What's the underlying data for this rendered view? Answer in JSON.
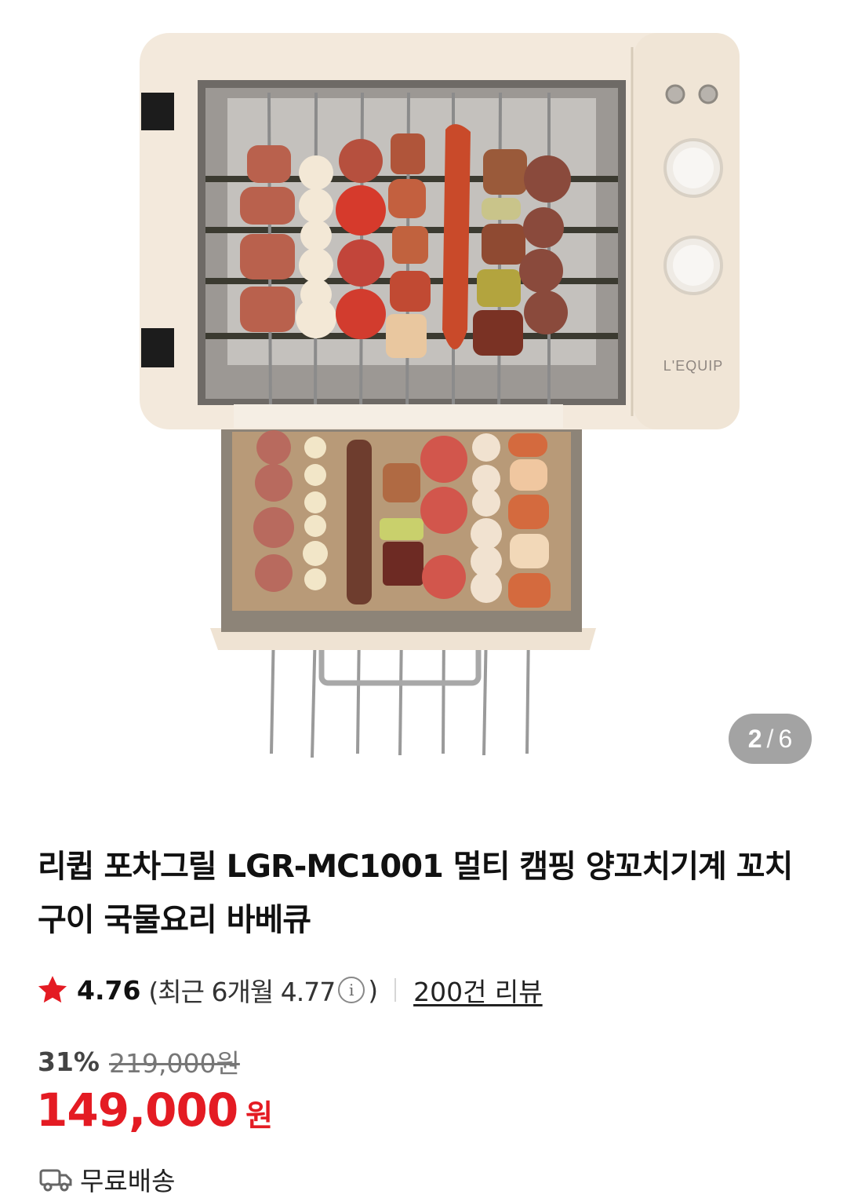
{
  "gallery": {
    "image_alt": "L'EQUIP",
    "current": "2",
    "separator": "/",
    "total": "6"
  },
  "product": {
    "title": "리큅 포차그릴 LGR-MC1001 멀티 캠핑 양꼬치기계 꼬치구이 국물요리 바베큐",
    "rating": "4.76",
    "recent_rating": "(최근 6개월 4.77",
    "recent_close": ")",
    "review_link": "200건 리뷰",
    "discount": "31%",
    "original_price": "219,000원",
    "price": "149,000",
    "currency": "원",
    "shipping": "무료배송"
  },
  "colors": {
    "accent": "#e41b23",
    "counter_bg": "#a3a3a3",
    "appliance_body": "#f3e9dc"
  }
}
